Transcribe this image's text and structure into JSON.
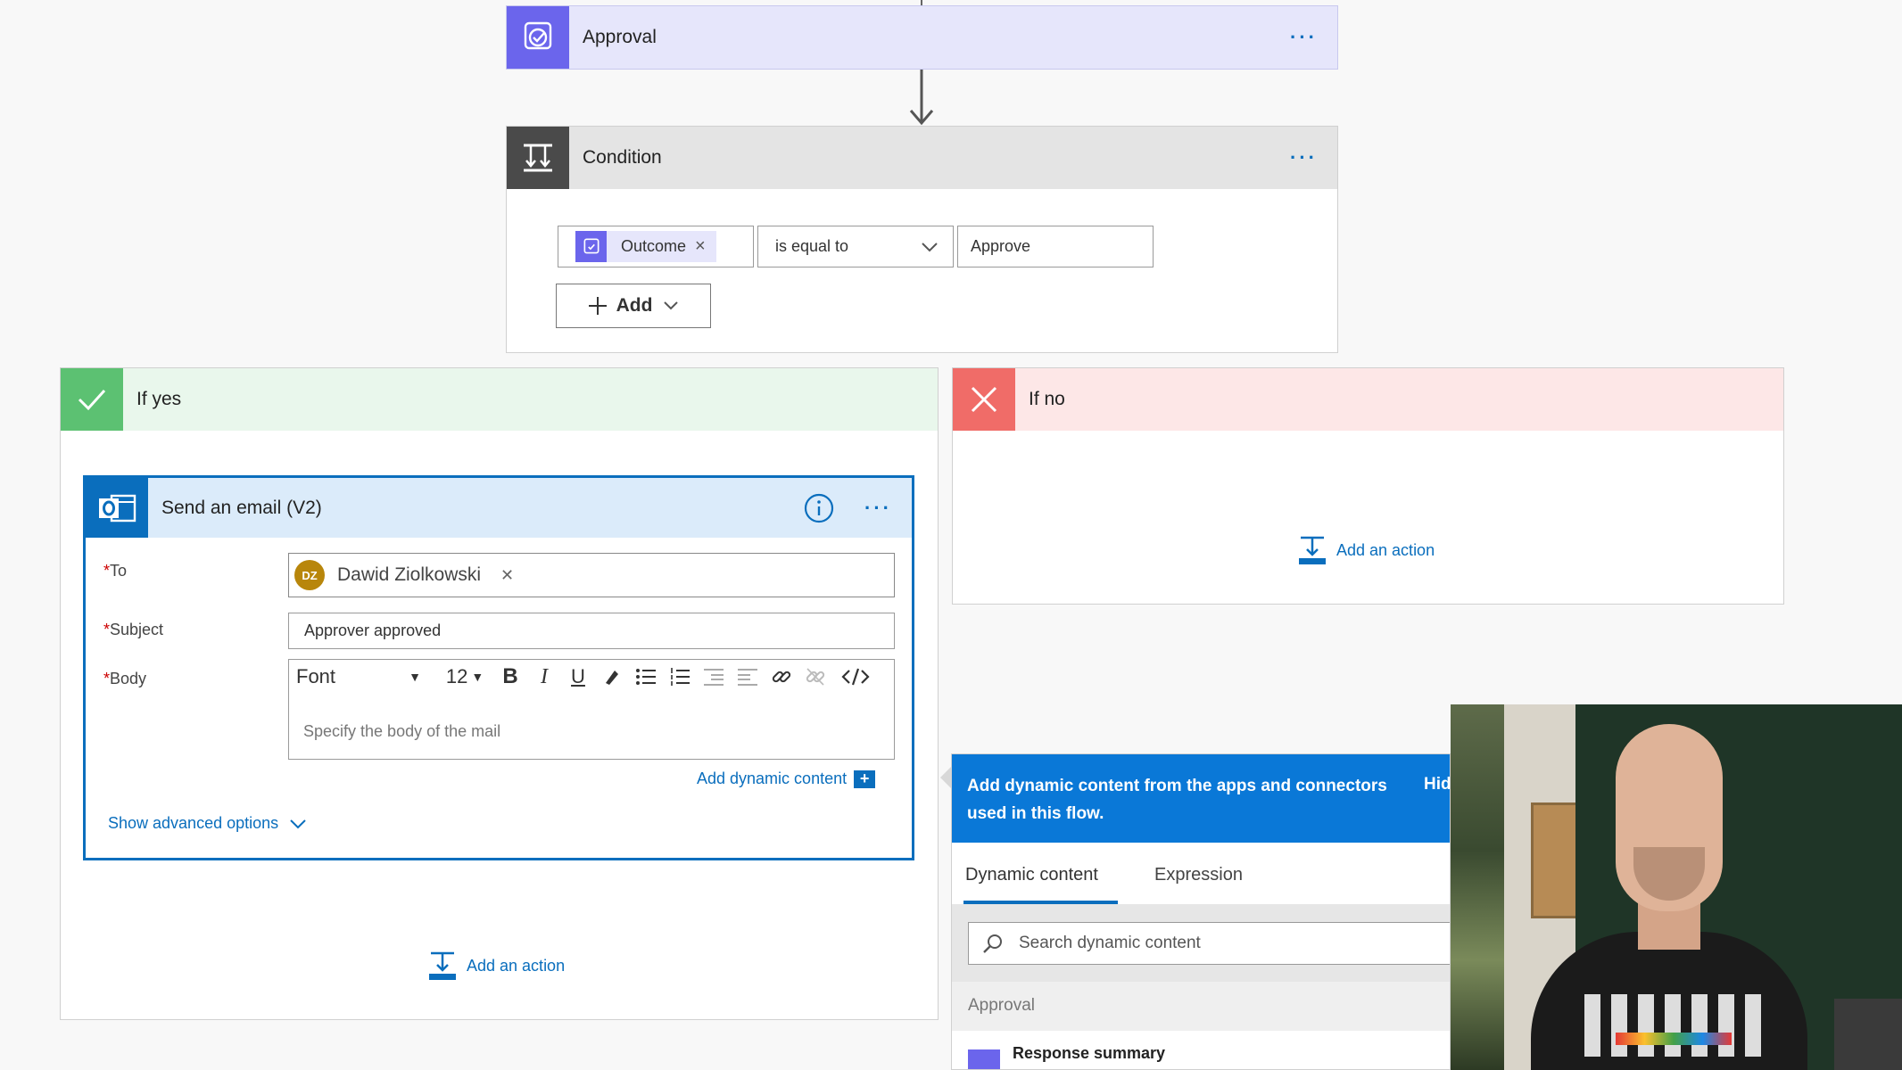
{
  "approval": {
    "title": "Approval",
    "more": "···"
  },
  "condition": {
    "title": "Condition",
    "more": "···",
    "token_label": "Outcome",
    "token_remove": "×",
    "operator": "is equal to",
    "value": "Approve",
    "add_label": "Add"
  },
  "if_yes": {
    "title": "If yes",
    "add_action": "Add an action"
  },
  "if_no": {
    "title": "If no",
    "add_action": "Add an action"
  },
  "send_email": {
    "title": "Send an email (V2)",
    "more": "···",
    "to_label": "To",
    "to_initials": "DZ",
    "to_name": "Dawid Ziolkowski",
    "to_remove": "✕",
    "subject_label": "Subject",
    "subject_value": "Approver approved",
    "body_label": "Body",
    "font_label": "Font",
    "font_size": "12",
    "body_placeholder": "Specify the body of the mail",
    "add_dynamic": "Add dynamic content",
    "show_advanced": "Show advanced options"
  },
  "dynamic_panel": {
    "banner": "Add dynamic content from the apps and connectors used in this flow.",
    "hide": "Hid",
    "tab_dynamic": "Dynamic content",
    "tab_expression": "Expression",
    "search_placeholder": "Search dynamic content",
    "section": "Approval",
    "item": "Response summary"
  },
  "colors": {
    "approval_accent": "#6b65ec",
    "approval_header": "#e6e6fb",
    "condition_accent": "#4a4a4a",
    "yes_accent": "#5cc172",
    "yes_header": "#e9f7ec",
    "no_accent": "#f06c68",
    "no_header": "#fde7e7",
    "email_accent": "#0a6ebd",
    "email_header": "#dbebfa",
    "dynamic_banner": "#0a78d7"
  },
  "icons": {
    "approval": "approval-icon",
    "condition": "condition-icon",
    "yes": "checkmark-icon",
    "no": "close-icon",
    "email": "outlook-icon",
    "info": "info-icon",
    "search": "search-icon",
    "add_action": "add-action-icon"
  }
}
